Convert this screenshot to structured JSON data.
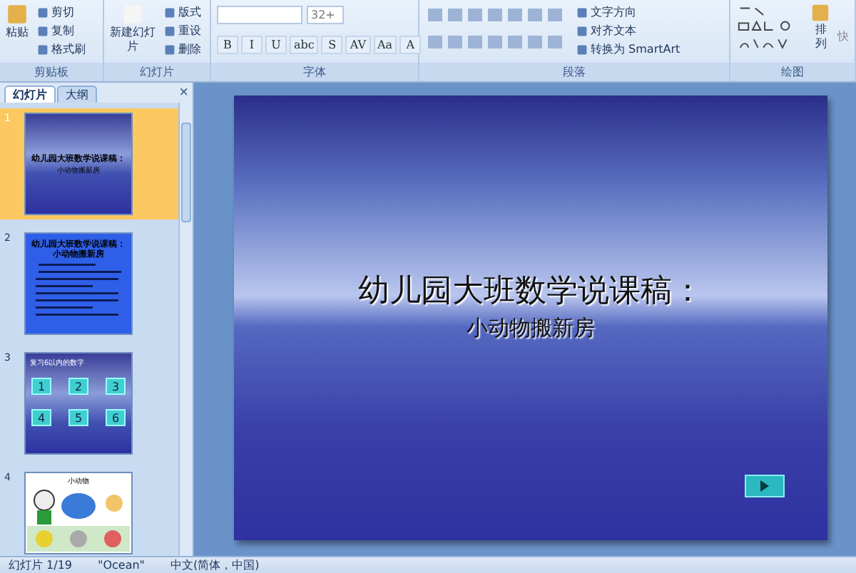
{
  "ribbon": {
    "clipboard": {
      "label": "剪贴板",
      "paste": "粘贴",
      "items": [
        "剪切",
        "复制",
        "格式刷"
      ]
    },
    "slides": {
      "label": "幻灯片",
      "new_slide": "新建幻灯片",
      "items": [
        "版式",
        "重设",
        "删除"
      ]
    },
    "font": {
      "label": "字体",
      "size": "32+",
      "buttons": [
        "B",
        "I",
        "U",
        "abc",
        "S",
        "AV",
        "Aa",
        "A"
      ]
    },
    "paragraph": {
      "label": "段落",
      "items": [
        "文字方向",
        "对齐文本",
        "转换为 SmartArt"
      ]
    },
    "drawing": {
      "label": "绘图",
      "arrange": "排列",
      "quick": "快"
    }
  },
  "panel": {
    "tabs": [
      {
        "label": "幻灯片",
        "selected": true
      },
      {
        "label": "大纲",
        "selected": false
      }
    ],
    "close": "×",
    "slides": [
      {
        "number": "1",
        "kind": "title",
        "selected": true,
        "title": "幼儿园大班数学说课稿：",
        "subtitle": "小动物搬新房"
      },
      {
        "number": "2",
        "kind": "text",
        "selected": false,
        "title": "幼儿园大班数学说课稿：小动物搬新房"
      },
      {
        "number": "3",
        "kind": "numbers",
        "selected": false,
        "title": "复习6以内的数字",
        "tiles": [
          "1",
          "2",
          "3",
          "4",
          "5",
          "6"
        ]
      },
      {
        "number": "4",
        "kind": "pictures",
        "selected": false,
        "title": "小动物"
      }
    ]
  },
  "slide": {
    "title": "幼儿园大班数学说课稿：",
    "subtitle": "小动物搬新房"
  },
  "status_bar": {
    "slide": "幻灯片 1/19",
    "theme": "\"Ocean\"",
    "language": "中文(简体，中国)"
  }
}
